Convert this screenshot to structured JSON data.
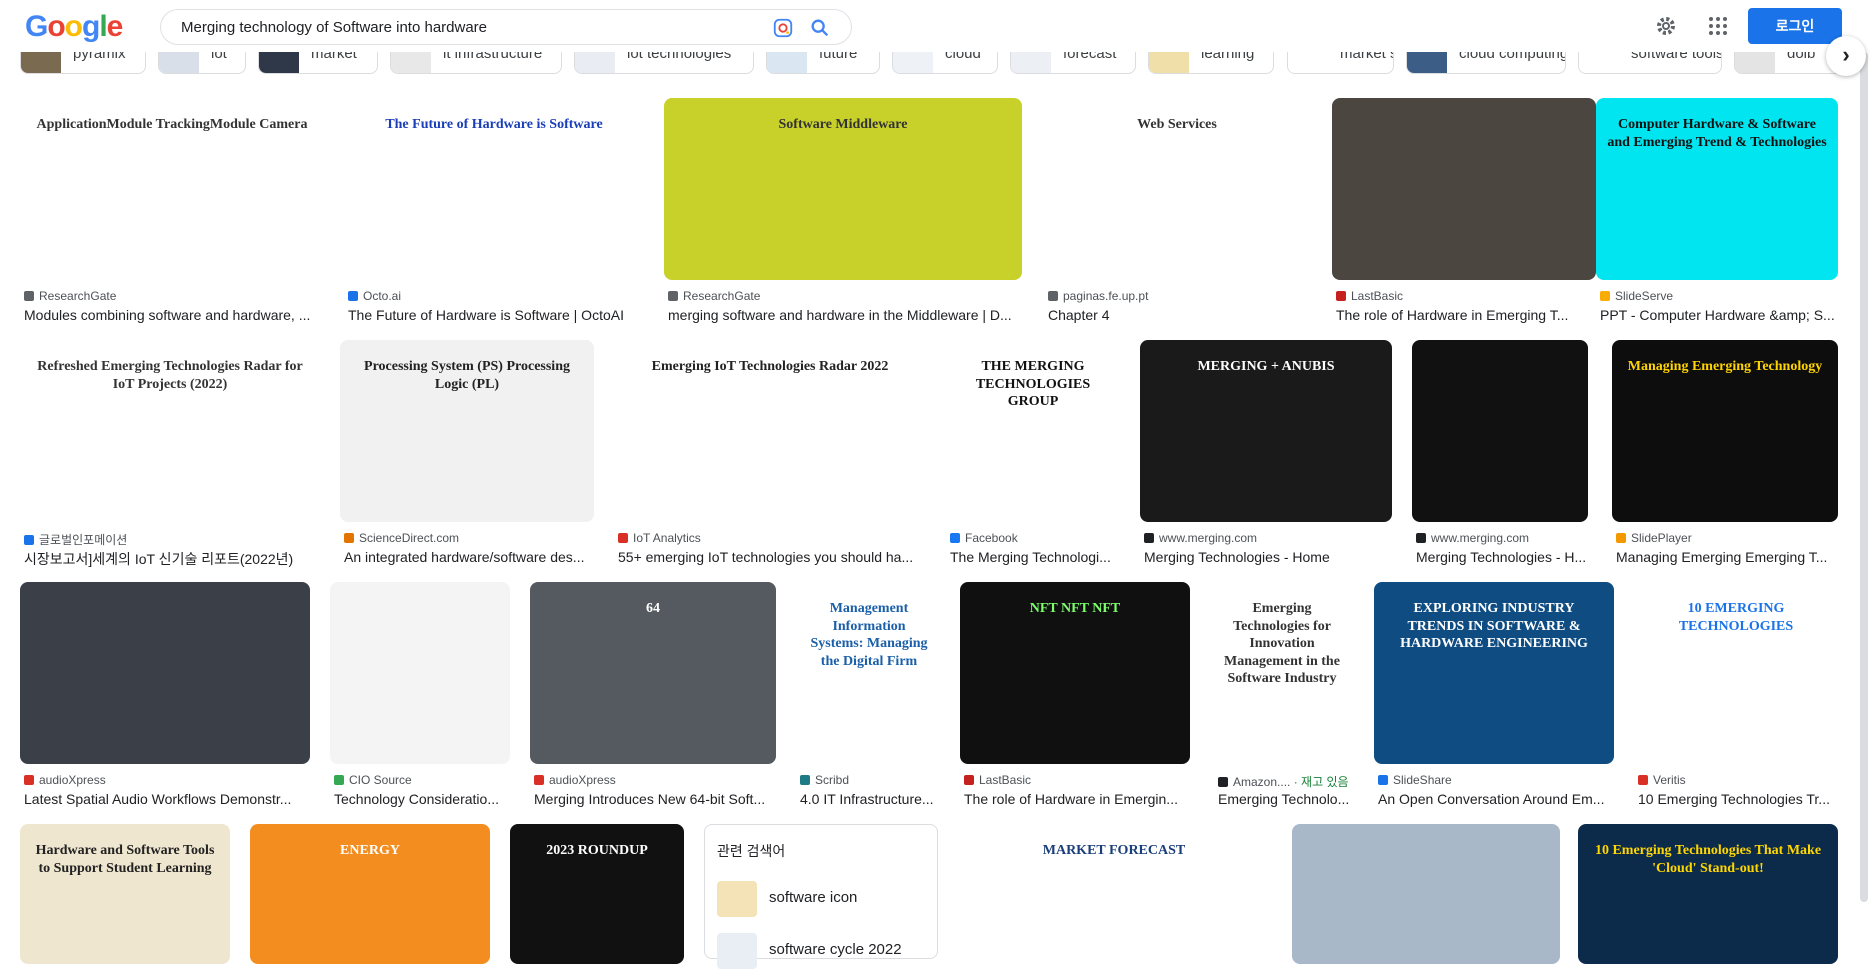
{
  "header": {
    "logo_letters": [
      {
        "ch": "G",
        "color": "#4285F4"
      },
      {
        "ch": "o",
        "color": "#EA4335"
      },
      {
        "ch": "o",
        "color": "#FBBC05"
      },
      {
        "ch": "g",
        "color": "#4285F4"
      },
      {
        "ch": "l",
        "color": "#34A853"
      },
      {
        "ch": "e",
        "color": "#EA4335"
      }
    ],
    "search_query": "Merging technology of Software into hardware",
    "login_label": "로그인",
    "accent": "#1a73e8"
  },
  "chips": [
    {
      "label": "pyramix",
      "thumb_color": "#7a6a50"
    },
    {
      "label": "iot",
      "thumb_color": "#d9dfe8"
    },
    {
      "label": "market",
      "thumb_color": "#2f3848"
    },
    {
      "label": "it infrastructure",
      "thumb_color": "#e8e8e8"
    },
    {
      "label": "iot technologies",
      "thumb_color": "#e9ecf3"
    },
    {
      "label": "future",
      "thumb_color": "#dbe6f3"
    },
    {
      "label": "cloud",
      "thumb_color": "#eef1f5"
    },
    {
      "label": "forecast",
      "thumb_color": "#eceff4"
    },
    {
      "label": "learning",
      "thumb_color": "#f1dfa9"
    },
    {
      "label": "market size",
      "thumb_color": "#ffffff"
    },
    {
      "label": "cloud computing",
      "thumb_color": "#3b5d86"
    },
    {
      "label": "software tools",
      "thumb_color": "#ffffff"
    },
    {
      "label": "dolb",
      "thumb_color": "#e4e4e4"
    }
  ],
  "rows": [
    [
      {
        "source": "ResearchGate",
        "title": "Modules combining software and hardware, ...",
        "src_color": "#5f6368",
        "img": {
          "bg": "#ffffff",
          "text": "ApplicationModule  TrackingModule  Camera",
          "fg": "#333333"
        }
      },
      {
        "source": "Octo.ai",
        "title": "The Future of Hardware is Software | OctoAI",
        "src_color": "#1a73e8",
        "img": {
          "bg": "#ffffff",
          "text": "The Future of Hardware is Software",
          "fg": "#1a3eb8"
        }
      },
      {
        "source": "ResearchGate",
        "title": "merging software and hardware in the Middleware | D...",
        "src_color": "#5f6368",
        "img": {
          "bg": "#c8d12a",
          "text": "Software Middleware",
          "fg": "#333333"
        }
      },
      {
        "source": "paginas.fe.up.pt",
        "title": "Chapter 4",
        "src_color": "#5f6368",
        "img": {
          "bg": "#ffffff",
          "text": "Web Services",
          "fg": "#333333"
        }
      },
      {
        "source": "LastBasic",
        "title": "The role of Hardware in Emerging T...",
        "src_color": "#c5221f",
        "img": {
          "bg": "#4b4740",
          "text": "",
          "fg": "#ffffff"
        }
      },
      {
        "source": "SlideServe",
        "title": "PPT - Computer Hardware &amp; S...",
        "src_color": "#f9ab00",
        "img": {
          "bg": "#00e5f0",
          "text": "Computer Hardware & Software and Emerging Trend & Technologies",
          "fg": "#111111"
        }
      }
    ],
    [
      {
        "source": "글로벌인포메이션",
        "title": "시장보고서]세계의 IoT 신기술 리포트(2022년)",
        "src_color": "#1a73e8",
        "img": {
          "bg": "#ffffff",
          "text": "Refreshed Emerging Technologies Radar for IoT Projects (2022)",
          "fg": "#333333"
        }
      },
      {
        "source": "ScienceDirect.com",
        "title": "An integrated hardware/software des...",
        "src_color": "#e37400",
        "img": {
          "bg": "#f1f1f1",
          "text": "Processing System (PS)   Processing Logic (PL)",
          "fg": "#222222"
        }
      },
      {
        "source": "IoT Analytics",
        "title": "55+ emerging IoT technologies you should ha...",
        "src_color": "#d93025",
        "img": {
          "bg": "#ffffff",
          "text": "Emerging IoT Technologies Radar 2022",
          "fg": "#222222"
        }
      },
      {
        "source": "Facebook",
        "title": "The Merging Technologi...",
        "src_color": "#1877f2",
        "img": {
          "bg": "#ffffff",
          "text": "THE MERGING TECHNOLOGIES GROUP",
          "fg": "#111111"
        }
      },
      {
        "source": "www.merging.com",
        "title": "Merging Technologies - Home",
        "src_color": "#202124",
        "img": {
          "bg": "#1a1a1a",
          "text": "MERGING + ANUBIS",
          "fg": "#ffffff"
        }
      },
      {
        "source": "www.merging.com",
        "title": "Merging Technologies - H...",
        "src_color": "#202124",
        "img": {
          "bg": "#111111",
          "text": "",
          "fg": "#ffffff"
        }
      },
      {
        "source": "SlidePlayer",
        "title": "Managing Emerging Emerging T...",
        "src_color": "#f29900",
        "img": {
          "bg": "#0d0d0d",
          "text": "Managing Emerging Technology",
          "fg": "#ffd400"
        }
      }
    ],
    [
      {
        "source": "audioXpress",
        "title": "Latest Spatial Audio Workflows Demonstr...",
        "src_color": "#d93025",
        "img": {
          "bg": "#3a3f48",
          "text": "",
          "fg": "#ffffff"
        }
      },
      {
        "source": "CIO Source",
        "title": "Technology Consideratio...",
        "src_color": "#34a853",
        "img": {
          "bg": "#f4f4f4",
          "text": "",
          "fg": "#333333"
        }
      },
      {
        "source": "audioXpress",
        "title": "Merging Introduces New 64-bit Soft...",
        "src_color": "#d93025",
        "img": {
          "bg": "#555a60",
          "text": "64",
          "fg": "#ffffff"
        }
      },
      {
        "source": "Scribd",
        "title": "4.0 IT Infrastructure...",
        "src_color": "#1e7b85",
        "img": {
          "bg": "#ffffff",
          "text": "Management Information Systems: Managing the Digital Firm",
          "fg": "#1a5fa8"
        }
      },
      {
        "source": "LastBasic",
        "title": "The role of Hardware in Emergin...",
        "src_color": "#c5221f",
        "img": {
          "bg": "#101010",
          "text": "NFT NFT NFT",
          "fg": "#7cff6b"
        }
      },
      {
        "source": "Amazon....",
        "stock": "· 재고 있음",
        "title": "Emerging Technolo...",
        "src_color": "#202124",
        "img": {
          "bg": "#ffffff",
          "text": "Emerging Technologies for Innovation Management in the Software Industry",
          "fg": "#333333"
        }
      },
      {
        "source": "SlideShare",
        "title": "An Open Conversation Around Em...",
        "src_color": "#1a73e8",
        "img": {
          "bg": "#0f4c81",
          "text": "EXPLORING INDUSTRY TRENDS IN SOFTWARE & HARDWARE ENGINEERING",
          "fg": "#ffffff"
        }
      },
      {
        "source": "Veritis",
        "title": "10 Emerging Technologies Tr...",
        "src_color": "#d93025",
        "img": {
          "bg": "#ffffff",
          "text": "10 EMERGING TECHNOLOGIES",
          "fg": "#1a73e8"
        }
      }
    ],
    [
      {
        "img": {
          "bg": "#efe6cf",
          "text": "Hardware and Software Tools to Support Student Learning",
          "fg": "#222222"
        }
      },
      {
        "img": {
          "bg": "#f38d1f",
          "text": "ENERGY",
          "fg": "#ffffff"
        }
      },
      {
        "img": {
          "bg": "#111111",
          "text": "2023 ROUNDUP",
          "fg": "#ffffff"
        }
      },
      {
        "img": {
          "bg": "#ffffff",
          "text": "MARKET FORECAST",
          "fg": "#1a3e7a"
        }
      },
      {
        "img": {
          "bg": "#a8b8c8",
          "text": "",
          "fg": "#ffffff"
        }
      },
      {
        "img": {
          "bg": "#0c2a4a",
          "text": "10 Emerging Technologies That Make 'Cloud' Stand-out!",
          "fg": "#ffd700"
        }
      }
    ]
  ],
  "related": {
    "title": "관련 검색어",
    "items": [
      {
        "label": "software icon"
      },
      {
        "label": "software cycle 2022"
      }
    ]
  }
}
